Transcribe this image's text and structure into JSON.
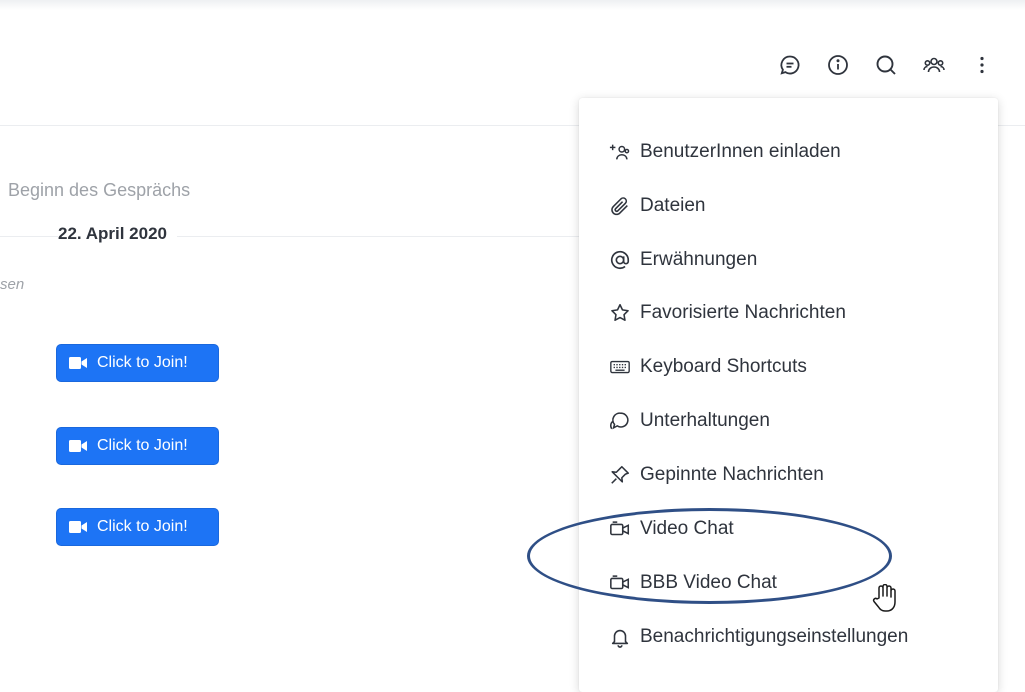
{
  "header": {
    "icons": [
      "discussion-icon",
      "info-icon",
      "search-icon",
      "members-icon",
      "kebab-menu-icon"
    ]
  },
  "conversation": {
    "start_text": "Beginn des Gesprächs",
    "date": "22. April 2020",
    "partial_text": "sen",
    "join_buttons": [
      "Click to Join!",
      "Click to Join!",
      "Click to Join!"
    ]
  },
  "menu": {
    "items": [
      {
        "label": "BenutzerInnen einladen",
        "icon": "add-user-icon"
      },
      {
        "label": "Dateien",
        "icon": "paperclip-icon"
      },
      {
        "label": "Erwähnungen",
        "icon": "at-icon"
      },
      {
        "label": "Favorisierte Nachrichten",
        "icon": "star-icon"
      },
      {
        "label": "Keyboard Shortcuts",
        "icon": "keyboard-icon"
      },
      {
        "label": "Unterhaltungen",
        "icon": "discussion-icon"
      },
      {
        "label": "Gepinnte Nachrichten",
        "icon": "pin-icon"
      },
      {
        "label": "Video Chat",
        "icon": "video-icon"
      },
      {
        "label": "BBB Video Chat",
        "icon": "video-icon"
      },
      {
        "label": "Benachrichtigungseinstellungen",
        "icon": "bell-icon"
      }
    ]
  },
  "colors": {
    "button_blue": "#1d74f5",
    "annotation_oval": "#2f4f86",
    "text": "#2f343d",
    "muted": "#9ea2a8"
  }
}
